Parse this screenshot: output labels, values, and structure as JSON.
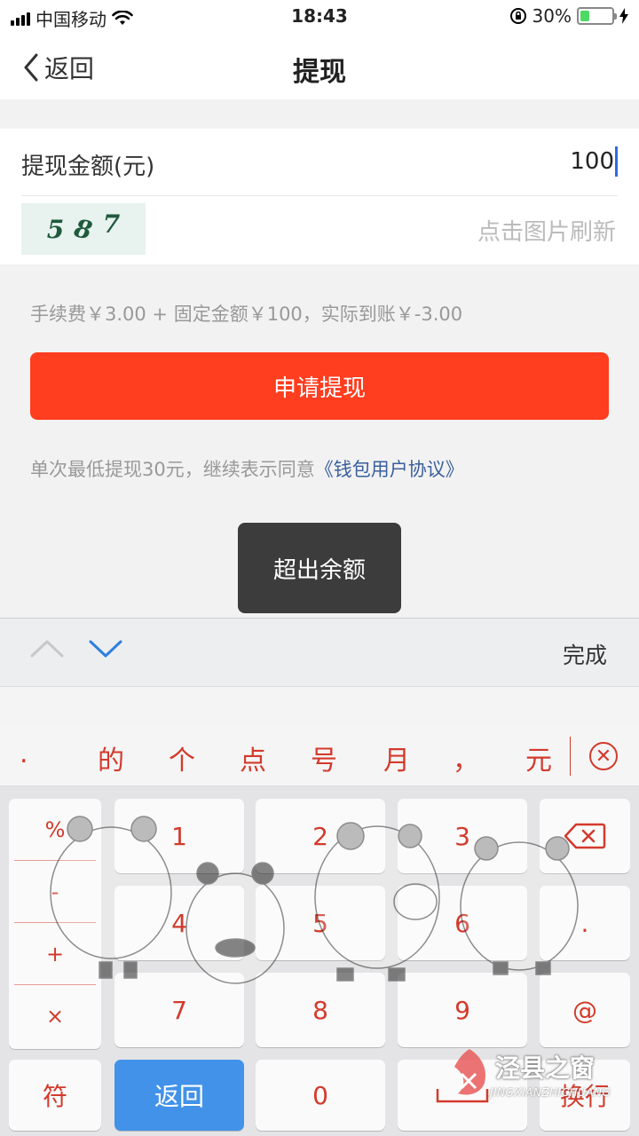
{
  "status_bar": {
    "carrier": "中国移动",
    "time": "18:43",
    "battery_percent": "30%",
    "battery_level": 0.3
  },
  "nav": {
    "back_label": "返回",
    "title": "提现"
  },
  "form": {
    "amount_label": "提现金额(元)",
    "amount_value": "100",
    "captcha_chars": [
      "5",
      "8",
      "7"
    ],
    "refresh_hint": "点击图片刷新"
  },
  "fee_text": "手续费￥3.00 + 固定金额￥100，实际到账￥-3.00",
  "withdraw_button": "申请提现",
  "agreement": {
    "prefix": "单次最低提现30元，继续表示同意",
    "link": "《钱包用户协议》"
  },
  "toast": "超出余额",
  "keyboard": {
    "done_label": "完成",
    "candidates": [
      ".",
      "的",
      "个",
      "点",
      "号",
      "月",
      "，",
      "元"
    ],
    "symbols": [
      "%",
      "-",
      "+",
      "×"
    ],
    "keys": [
      "1",
      "2",
      "3",
      "4",
      "5",
      "6",
      "7",
      "8",
      "9",
      "0"
    ],
    "dot_key": ".",
    "at_key": "@",
    "switch_label": "符",
    "return_label": "返回",
    "newline_label": "换行"
  },
  "watermark": {
    "title": "泾县之窗",
    "subtitle": "JINGXIANZHICHUANG"
  }
}
